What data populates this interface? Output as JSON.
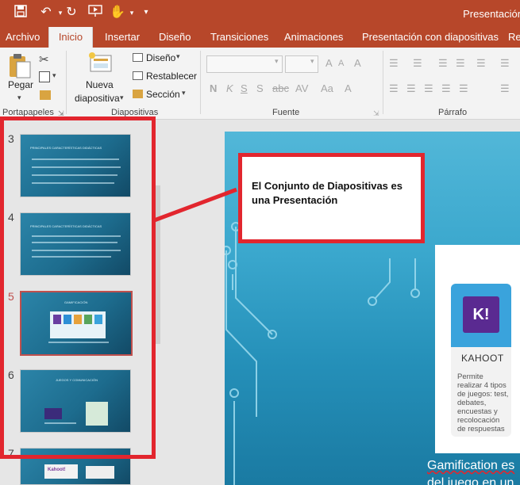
{
  "window": {
    "title": "Presentación"
  },
  "tabs": [
    "Archivo",
    "Inicio",
    "Insertar",
    "Diseño",
    "Transiciones",
    "Animaciones",
    "Presentación con diapositivas",
    "Re"
  ],
  "ribbon": {
    "paste_label": "Pegar",
    "new_slide_label_1": "Nueva",
    "new_slide_label_2": "diapositiva",
    "layout_label": "Diseño",
    "reset_label": "Restablecer",
    "section_label": "Sección",
    "groups": {
      "clipboard": "Portapapeles",
      "slides": "Diapositivas",
      "font": "Fuente",
      "paragraph": "Párrafo"
    }
  },
  "thumbnails": [
    {
      "number": "3",
      "title": "PRINCIPALES CARACTERÍSTICAS DIDÁCTICAS"
    },
    {
      "number": "4",
      "title": "PRINCIPALES CARACTERÍSTICAS DIDÁCTICAS"
    },
    {
      "number": "5",
      "title": "GAMIFICACIÓN",
      "selected": true
    },
    {
      "number": "6",
      "title": "JUEGOS Y COMUNICACIÓN"
    },
    {
      "number": "7",
      "title": "Kahoot!"
    }
  ],
  "callout": {
    "text": "El Conjunto de Diapositivas es una Presentación"
  },
  "slide": {
    "card_logo": "K!",
    "card_name": "KAHOOT",
    "card_desc": "Permite realizar 4 tipos de juegos: test, debates, encuestas y recolocación de respuestas",
    "bottom_text_1": "Gamification es",
    "bottom_text_2": "del juego en un"
  },
  "colors": {
    "brand": "#b7472a",
    "highlight": "#e2262e",
    "slide_bg": "#3aa7cd"
  }
}
